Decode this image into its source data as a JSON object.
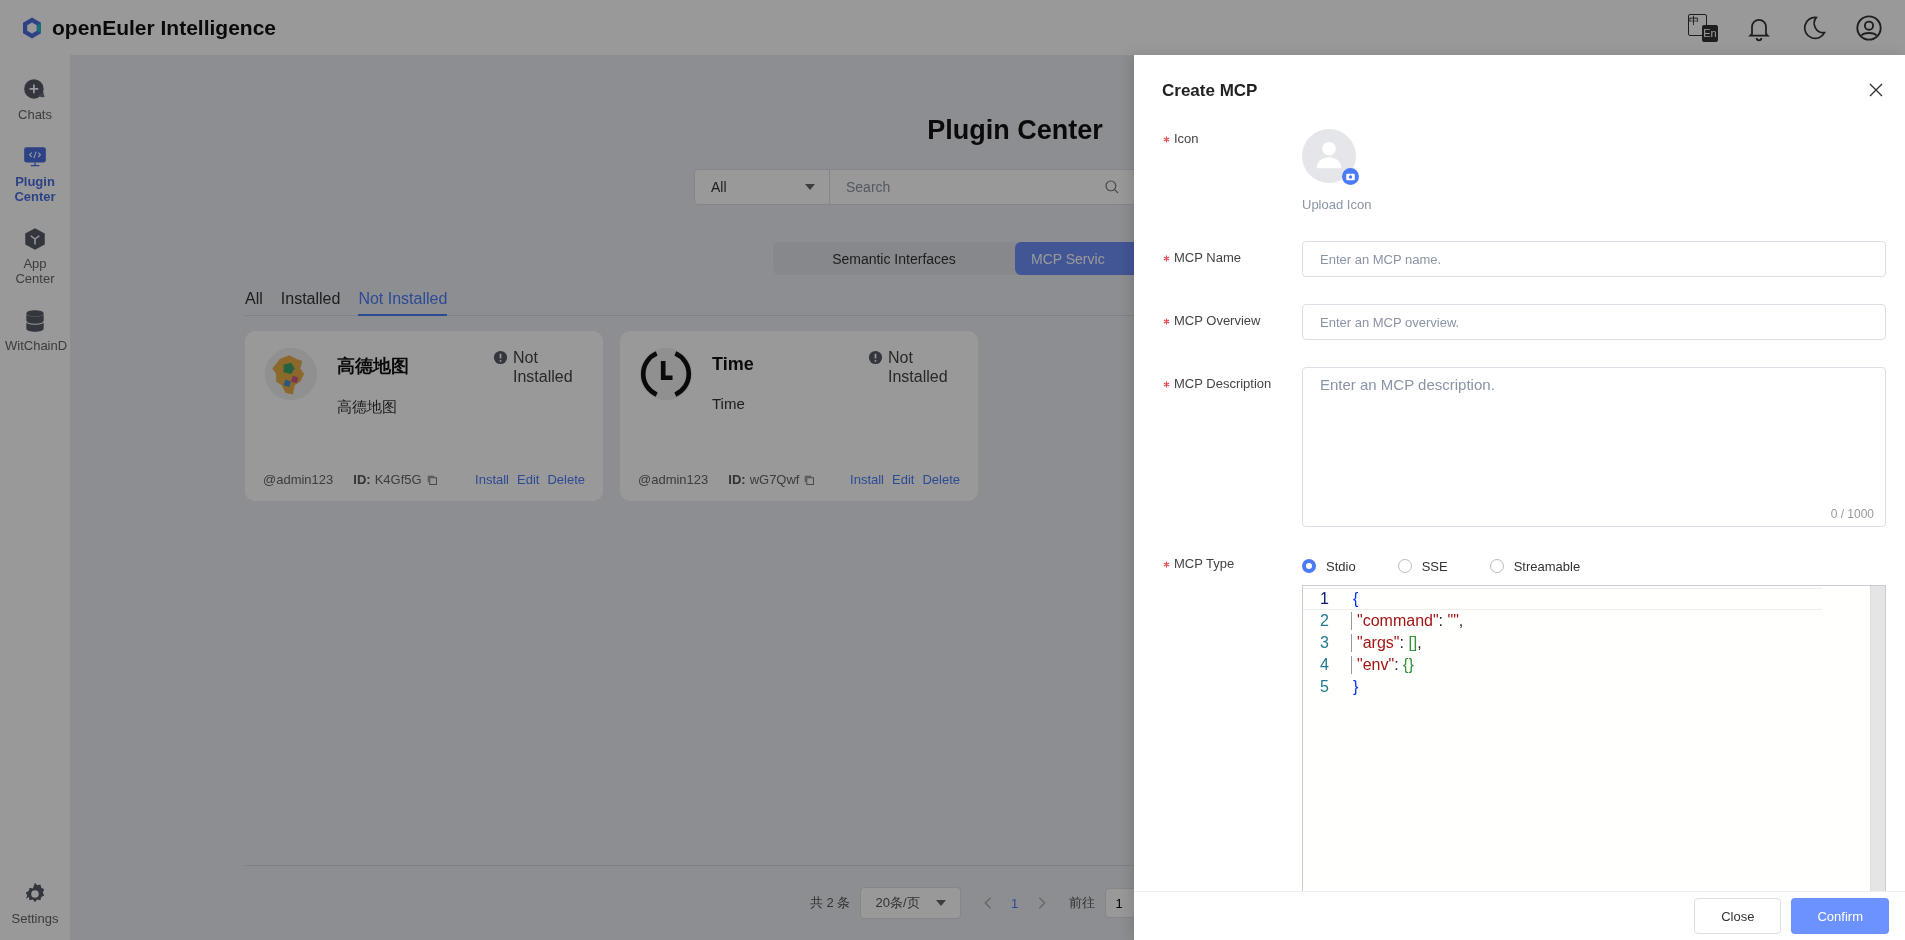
{
  "header": {
    "title": "openEuler Intelligence",
    "language": {
      "primary": "中",
      "secondary": "En"
    }
  },
  "sidebar": {
    "items": [
      {
        "label": "Chats",
        "kind": "chat",
        "selected": false
      },
      {
        "label": "Plugin Center",
        "kind": "plugin",
        "selected": true
      },
      {
        "label": "App Center",
        "kind": "app",
        "selected": false
      },
      {
        "label": "WitChainD",
        "kind": "database",
        "selected": false
      }
    ],
    "footer": {
      "label": "Settings"
    }
  },
  "page": {
    "title": "Plugin Center",
    "search": {
      "filter": "All",
      "placeholder": "Search"
    },
    "segments": [
      {
        "label": "Semantic Interfaces",
        "selected": false
      },
      {
        "label": "MCP Servic",
        "selected": true
      }
    ],
    "filters": [
      {
        "label": "All",
        "selected": false
      },
      {
        "label": "Installed",
        "selected": false
      },
      {
        "label": "Not Installed",
        "selected": true
      }
    ],
    "cards": [
      {
        "kind": "map",
        "name": "高德地图",
        "description": "高德地图",
        "status": "Not Installed",
        "author": "@admin123",
        "id_label": "ID:",
        "id": "K4Gf5G",
        "actions": [
          "Install",
          "Edit",
          "Delete"
        ]
      },
      {
        "kind": "clock",
        "name": "Time",
        "description": "Time",
        "status": "Not Installed",
        "author": "@admin123",
        "id_label": "ID:",
        "id": "wG7Qwf",
        "actions": [
          "Install",
          "Edit",
          "Delete"
        ]
      }
    ],
    "pagination": {
      "total": "共 2 条",
      "page_size": "20条/页",
      "pages": [
        {
          "label": "1",
          "selected": true
        }
      ],
      "goto_label": "前往",
      "goto_value": "1"
    }
  },
  "drawer": {
    "title": "Create MCP",
    "fields": [
      {
        "kind": "upload",
        "label": "Icon",
        "required": true,
        "caption": "Upload Icon"
      },
      {
        "kind": "input",
        "label": "MCP Name",
        "required": true,
        "placeholder": "Enter an MCP name."
      },
      {
        "kind": "input",
        "label": "MCP Overview",
        "required": true,
        "placeholder": "Enter an MCP overview."
      },
      {
        "kind": "textarea",
        "label": "MCP Description",
        "required": true,
        "placeholder": "Enter an MCP description.",
        "counter": "0 / 1000"
      },
      {
        "kind": "radio",
        "label": "MCP Type",
        "required": true,
        "options": [
          {
            "label": "Stdio",
            "selected": true
          },
          {
            "label": "SSE",
            "selected": false
          },
          {
            "label": "Streamable",
            "selected": false
          }
        ]
      }
    ],
    "code": [
      {
        "number": "1",
        "current": true,
        "indented": false,
        "tokens": [
          {
            "kind": "brace",
            "text": "{"
          }
        ]
      },
      {
        "number": "2",
        "current": false,
        "indented": true,
        "tokens": [
          {
            "kind": "key",
            "text": "\"command\""
          },
          {
            "kind": "punct",
            "text": ": "
          },
          {
            "kind": "string",
            "text": "\"\""
          },
          {
            "kind": "punct",
            "text": ","
          }
        ]
      },
      {
        "number": "3",
        "current": false,
        "indented": true,
        "tokens": [
          {
            "kind": "key",
            "text": "\"args\""
          },
          {
            "kind": "punct",
            "text": ": "
          },
          {
            "kind": "bracket",
            "text": "[]"
          },
          {
            "kind": "punct",
            "text": ","
          }
        ]
      },
      {
        "number": "4",
        "current": false,
        "indented": true,
        "tokens": [
          {
            "kind": "key",
            "text": "\"env\""
          },
          {
            "kind": "punct",
            "text": ": "
          },
          {
            "kind": "bracket",
            "text": "{}"
          }
        ]
      },
      {
        "number": "5",
        "current": false,
        "indented": false,
        "tokens": [
          {
            "kind": "brace",
            "text": "}"
          }
        ]
      }
    ],
    "buttons": [
      {
        "kind": "default",
        "label": "Close"
      },
      {
        "kind": "primary",
        "label": "Confirm"
      }
    ]
  }
}
